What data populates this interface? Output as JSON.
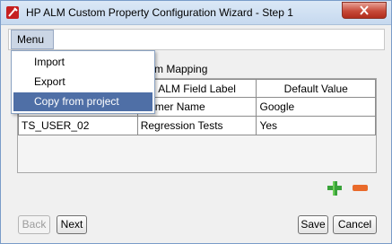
{
  "window": {
    "title": "HP ALM Custom Property Configuration Wizard - Step 1",
    "close_label": "✕"
  },
  "menubar": {
    "menu_label": "Menu"
  },
  "dropdown": {
    "items": [
      {
        "label": "Import",
        "selected": false
      },
      {
        "label": "Export",
        "selected": false
      },
      {
        "label": "Copy from project",
        "selected": true
      }
    ]
  },
  "section": {
    "label": "m Mapping"
  },
  "table": {
    "headers": [
      "",
      "ALM Field Label",
      "Default Value"
    ],
    "rows": [
      [
        "",
        "stomer Name",
        "Google"
      ],
      [
        "TS_USER_02",
        "Regression Tests",
        "Yes"
      ]
    ]
  },
  "actions": {
    "add_icon": "green-plus-icon",
    "remove_icon": "orange-minus-icon"
  },
  "buttons": {
    "back": "Back",
    "next": "Next",
    "save": "Save",
    "cancel": "Cancel"
  },
  "colors": {
    "titlebar": "#c6d9ef",
    "selection": "#4f6fa6",
    "add": "#3aa33a",
    "remove": "#e96a2a",
    "close": "#c74a39"
  }
}
